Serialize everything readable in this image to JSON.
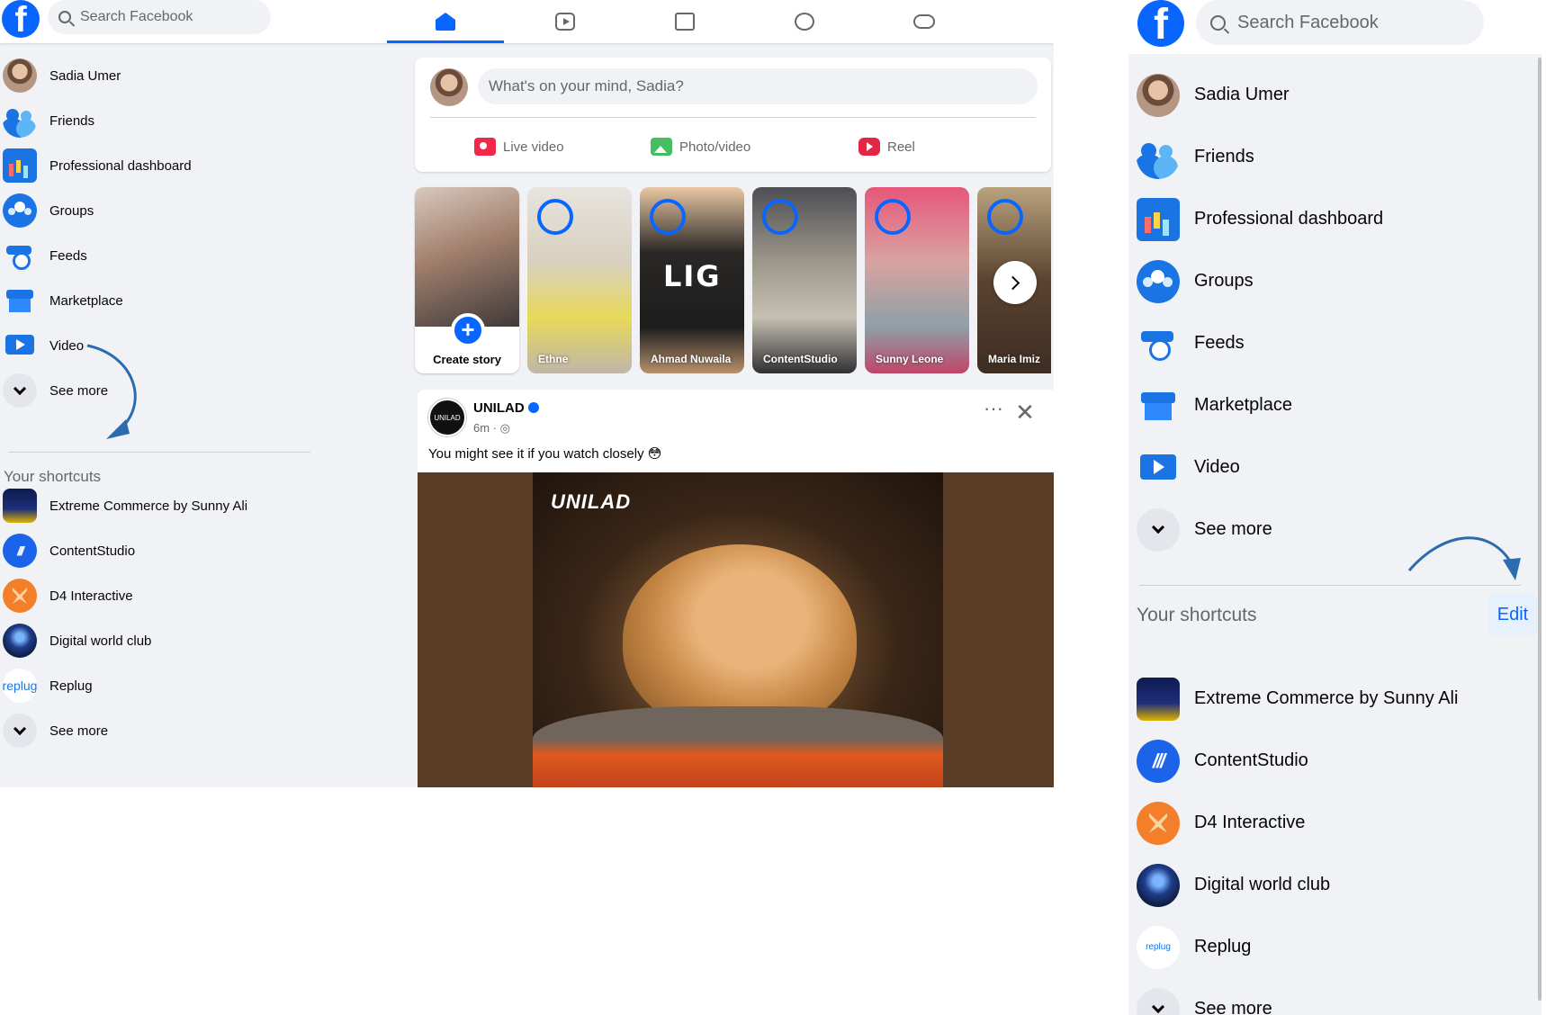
{
  "left": {
    "search": {
      "placeholder": "Search Facebook"
    },
    "nav_tabs": [
      {
        "name": "home",
        "icon": "home-icon",
        "active": true
      },
      {
        "name": "video",
        "icon": "video-icon",
        "active": false
      },
      {
        "name": "marketplace",
        "icon": "marketplace-icon",
        "active": false
      },
      {
        "name": "groups",
        "icon": "groups-icon",
        "active": false
      },
      {
        "name": "gaming",
        "icon": "gaming-icon",
        "active": false
      }
    ],
    "sidebar": {
      "items": [
        {
          "label": "Sadia Umer",
          "icon": "profile-avatar"
        },
        {
          "label": "Friends",
          "icon": "friends-icon"
        },
        {
          "label": "Professional dashboard",
          "icon": "dashboard-icon"
        },
        {
          "label": "Groups",
          "icon": "groups-icon"
        },
        {
          "label": "Feeds",
          "icon": "feeds-icon"
        },
        {
          "label": "Marketplace",
          "icon": "marketplace-icon"
        },
        {
          "label": "Video",
          "icon": "video-icon"
        },
        {
          "label": "See more",
          "icon": "chevron-down-icon"
        }
      ],
      "shortcuts_heading": "Your shortcuts",
      "shortcuts": [
        {
          "label": "Extreme Commerce by Sunny Ali"
        },
        {
          "label": "ContentStudio",
          "mark": "///"
        },
        {
          "label": "D4 Interactive"
        },
        {
          "label": "Digital world club"
        },
        {
          "label": "Replug",
          "mark": "replug"
        },
        {
          "label": "See more"
        }
      ]
    },
    "composer": {
      "placeholder": "What's on your mind, Sadia?",
      "actions": {
        "live": "Live video",
        "photo": "Photo/video",
        "reel": "Reel"
      }
    },
    "stories": {
      "create_label": "Create story",
      "items": [
        {
          "label": "Ethne"
        },
        {
          "label": "Ahmad Nuwaila",
          "overlay": "LIG"
        },
        {
          "label": "ContentStudio"
        },
        {
          "label": "Sunny Leone"
        },
        {
          "label": "Maria Imiz"
        }
      ]
    },
    "post": {
      "author": "UNILAD",
      "time": "6m · ◎",
      "avatar_text": "UNILAD",
      "text": "You might see it if you watch closely 😳",
      "media_brand": "UNILAD",
      "more": "···",
      "close": "✕"
    }
  },
  "right": {
    "search": {
      "placeholder": "Search Facebook"
    },
    "sidebar": {
      "items": [
        {
          "label": "Sadia Umer"
        },
        {
          "label": "Friends"
        },
        {
          "label": "Professional dashboard"
        },
        {
          "label": "Groups"
        },
        {
          "label": "Feeds"
        },
        {
          "label": "Marketplace"
        },
        {
          "label": "Video"
        },
        {
          "label": "See more"
        }
      ],
      "shortcuts_heading": "Your shortcuts",
      "edit_label": "Edit",
      "shortcuts": [
        {
          "label": "Extreme Commerce by Sunny Ali"
        },
        {
          "label": "ContentStudio",
          "mark": "///"
        },
        {
          "label": "D4 Interactive"
        },
        {
          "label": "Digital world club"
        },
        {
          "label": "Replug",
          "mark": "replug"
        },
        {
          "label": "See more"
        }
      ]
    }
  },
  "colors": {
    "brand": "#0866ff",
    "annotation_arrow": "#2b6cb0",
    "page_bg": "#f0f2f5"
  }
}
